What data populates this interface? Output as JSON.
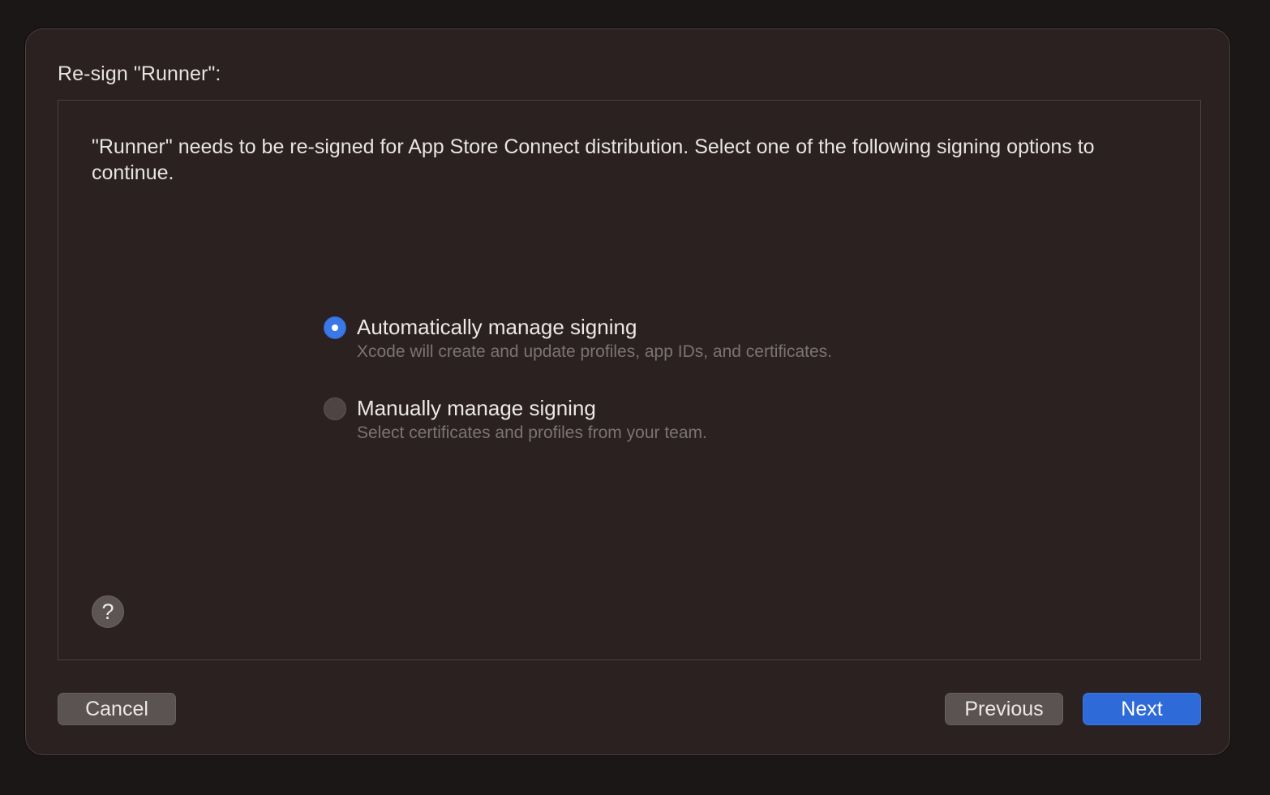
{
  "sheet": {
    "title": "Re-sign \"Runner\":"
  },
  "content": {
    "description": "\"Runner\" needs to be re-signed for App Store Connect distribution. Select one of the following signing options to continue.",
    "options": [
      {
        "label": "Automatically manage signing",
        "sublabel": "Xcode will create and update profiles, app IDs, and certificates.",
        "selected": true
      },
      {
        "label": "Manually manage signing",
        "sublabel": "Select certificates and profiles from your team.",
        "selected": false
      }
    ],
    "help_glyph": "?",
    "help_icon": "question-mark-icon"
  },
  "footer": {
    "cancel_label": "Cancel",
    "previous_label": "Previous",
    "next_label": "Next"
  },
  "colors": {
    "accent": "#3a78e8",
    "background": "#2a2120"
  }
}
